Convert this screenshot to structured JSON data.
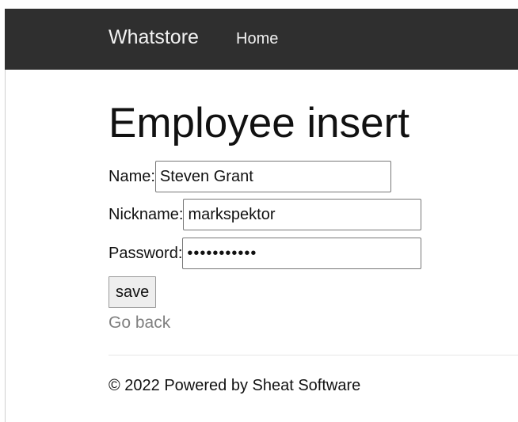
{
  "navbar": {
    "brand": "Whatstore",
    "links": [
      {
        "label": "Home"
      }
    ],
    "background_color": "#2f2f2f"
  },
  "main": {
    "title": "Employee insert",
    "form": {
      "name": {
        "label": "Name:",
        "value": "Steven Grant"
      },
      "nickname": {
        "label": "Nickname:",
        "value": "markspektor"
      },
      "password": {
        "label": "Password:",
        "value": "xxxxxxxxxxx"
      }
    },
    "save_label": "save",
    "go_back_label": "Go back"
  },
  "footer": {
    "text": "© 2022 Powered by Sheat Software"
  }
}
